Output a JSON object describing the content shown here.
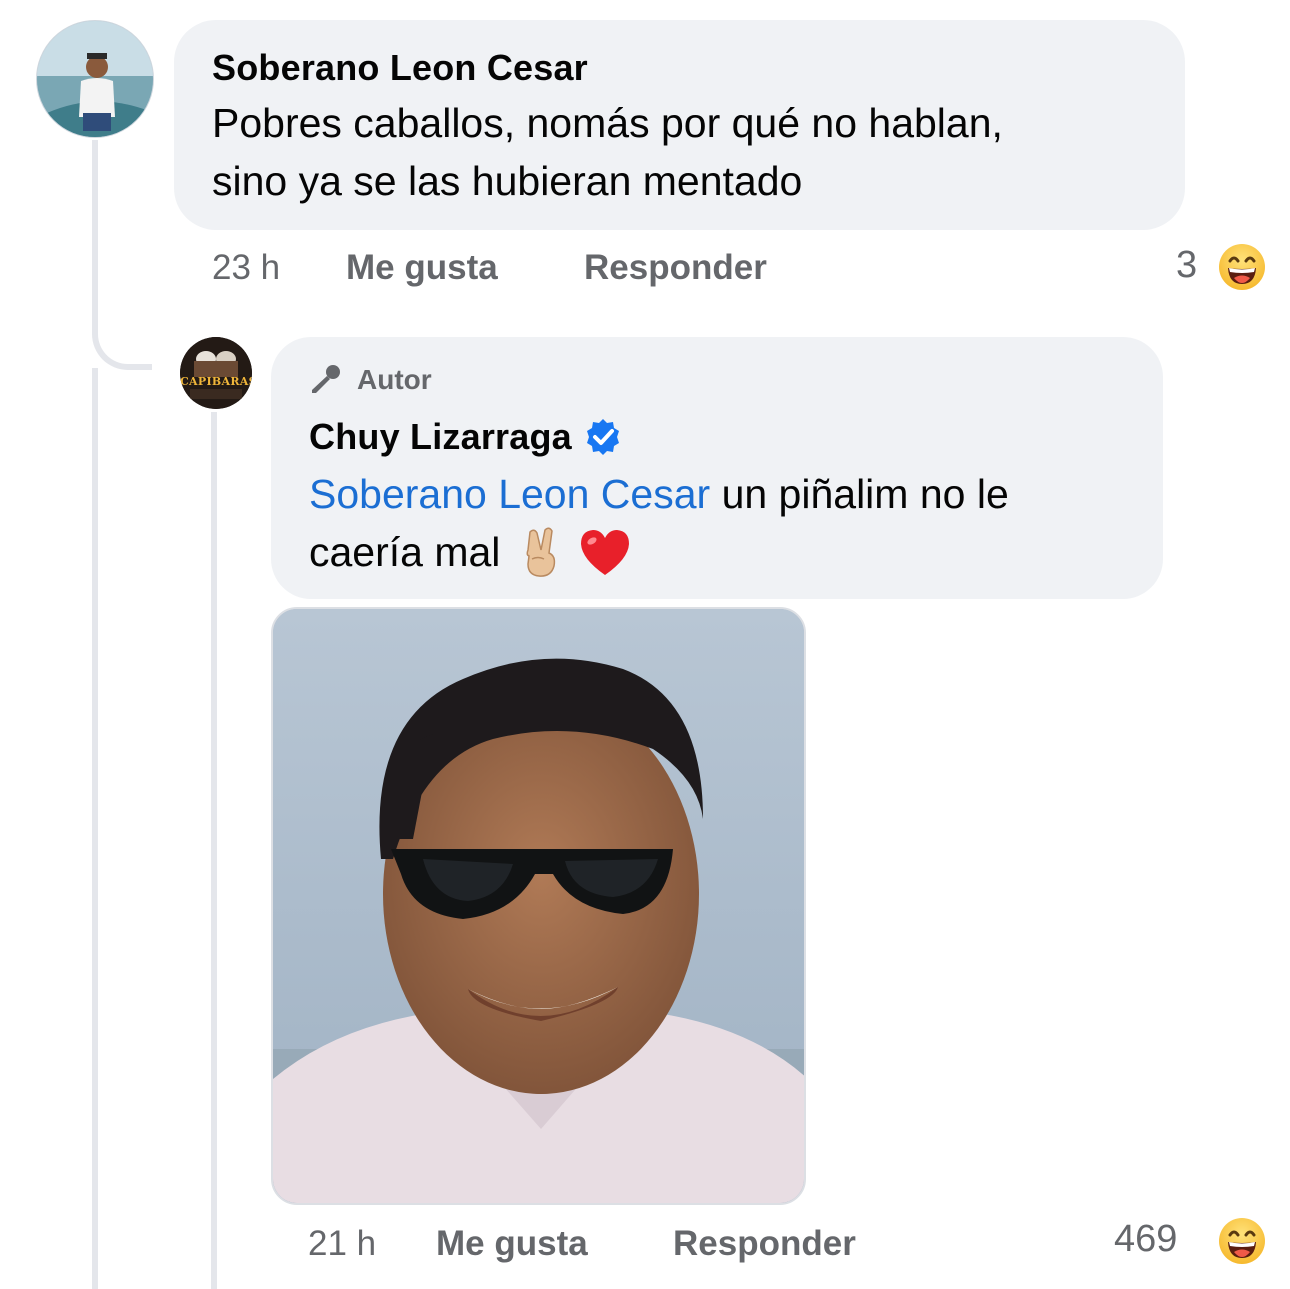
{
  "comment": {
    "author": "Soberano Leon Cesar",
    "text_line1": "Pobres caballos, nomás por qué no hablan,",
    "text_line2": "sino ya se las hubieran mentado",
    "time": "23 h",
    "like_label": "Me gusta",
    "reply_label": "Responder",
    "reaction_count": "3"
  },
  "reply": {
    "badge_label": "Autor",
    "author": "Chuy Lizarraga",
    "mention": "Soberano Leon Cesar",
    "text_rest": " un piñalim no le",
    "text_line2": "caería mal",
    "avatar_logo_text": "CAPIBARAS",
    "time": "21 h",
    "like_label": "Me gusta",
    "reply_label": "Responder",
    "reaction_count": "469"
  },
  "colors": {
    "bubble": "#f0f2f5",
    "meta_text": "#65676b",
    "mention": "#1b6ed3",
    "verified": "#1877f2",
    "thread_line": "#e4e6eb"
  }
}
